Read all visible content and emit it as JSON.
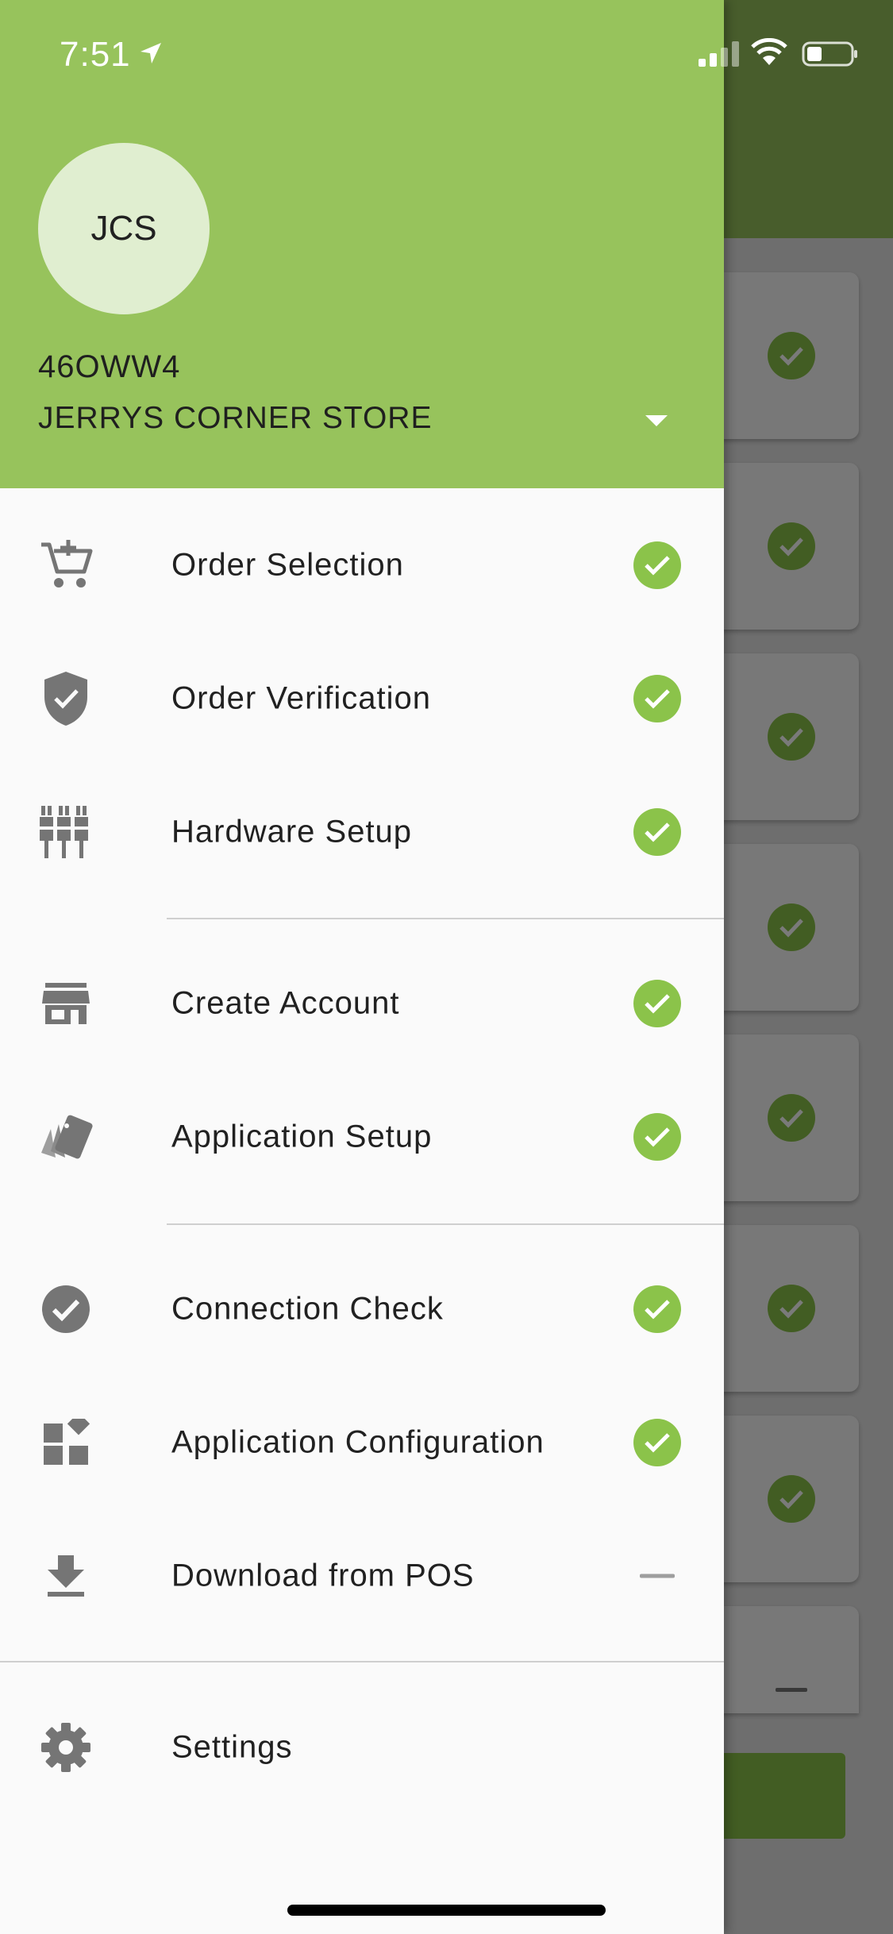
{
  "status_bar": {
    "time": "7:51"
  },
  "drawer": {
    "avatar_initials": "JCS",
    "store_code": "46OWW4",
    "store_name": "JERRYS CORNER STORE",
    "menu_groups": [
      [
        {
          "label": "Order Selection",
          "icon": "cart-plus-icon",
          "status": "complete"
        },
        {
          "label": "Order Verification",
          "icon": "shield-check-icon",
          "status": "complete"
        },
        {
          "label": "Hardware Setup",
          "icon": "connectors-icon",
          "status": "complete"
        }
      ],
      [
        {
          "label": "Create Account",
          "icon": "store-icon",
          "status": "complete"
        },
        {
          "label": "Application Setup",
          "icon": "cards-icon",
          "status": "complete"
        }
      ],
      [
        {
          "label": "Connection Check",
          "icon": "check-circle-icon",
          "status": "complete"
        },
        {
          "label": "Application Configuration",
          "icon": "widgets-icon",
          "status": "complete"
        },
        {
          "label": "Download from POS",
          "icon": "download-icon",
          "status": "pending"
        }
      ],
      [
        {
          "label": "Settings",
          "icon": "gear-icon",
          "status": "none"
        }
      ]
    ]
  },
  "colors": {
    "header_green": "#97c35c",
    "check_green": "#8bc34a",
    "icon_gray": "#757575"
  }
}
